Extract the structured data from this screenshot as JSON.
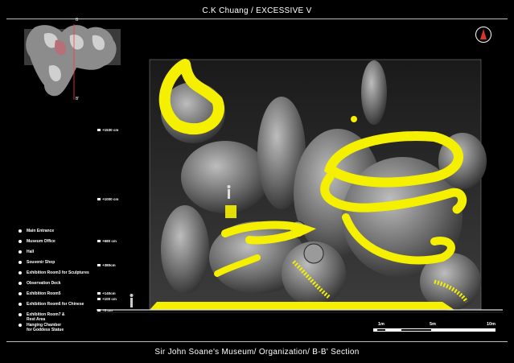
{
  "header": {
    "title": "C.K Chuang / EXCESSIVE V"
  },
  "keyplan": {
    "mark_top": "B",
    "mark_bottom": "B'"
  },
  "legend": {
    "items": [
      "Main Entrance",
      "Museum Office",
      "Hall",
      "Souvenir Shop",
      "Exhibition Room3 for Sculptures",
      "Observation Deck",
      "Exhibition Room5",
      "Exhibition Room6 for Chinese",
      "Exhibition Room7 &\nRest Area",
      "Hanging Chamber\nfor Goddess Statue"
    ]
  },
  "elevations": [
    {
      "label": "+1530 cm"
    },
    {
      "label": "+1000 cm"
    },
    {
      "label": "+680 cm"
    },
    {
      "label": "+380cm"
    },
    {
      "label": "+140cm"
    },
    {
      "label": "+100 cm"
    },
    {
      "label": "+0 cm"
    }
  ],
  "scale": {
    "labels": [
      "1m",
      "5m",
      "10m"
    ]
  },
  "footer": {
    "caption": "Sir John Soane's Museum/ Organization/ B-B' Section"
  },
  "colors": {
    "accent": "#f5f000",
    "compass": "#d9342b",
    "frame": "#bdbdbd"
  }
}
